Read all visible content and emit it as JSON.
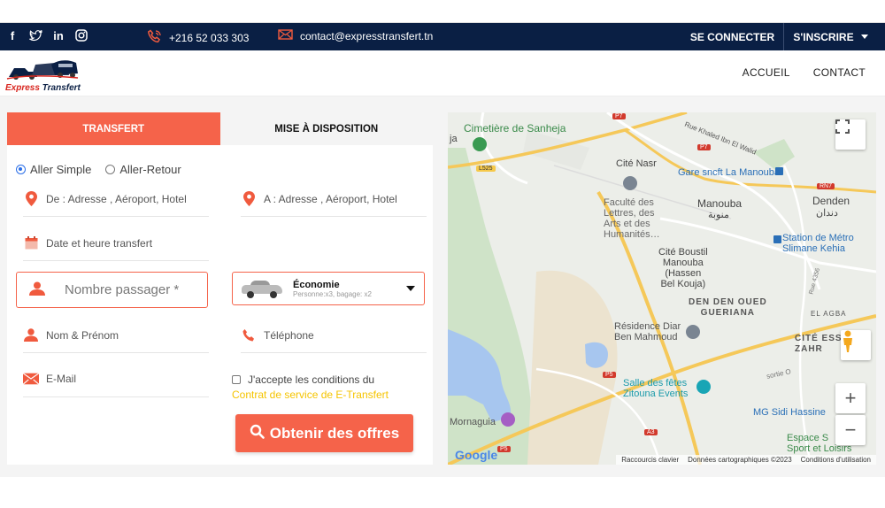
{
  "topbar": {
    "social": [
      "facebook-icon",
      "twitter-icon",
      "linkedin-icon",
      "instagram-icon"
    ],
    "phone": "+216 52 033 303",
    "email": "contact@expresstransfert.tn",
    "login": "SE CONNECTER",
    "signup": "S'INSCRIRE"
  },
  "header": {
    "logo_text_a": "Express",
    "logo_text_b": "Transfert",
    "nav": [
      "ACCUEIL",
      "CONTACT"
    ]
  },
  "form": {
    "tabs": [
      "TRANSFERT",
      "MISE À DISPOSITION"
    ],
    "radio_one_way": "Aller Simple",
    "radio_round": "Aller-Retour",
    "from_placeholder": "De : Adresse , Aéroport, Hotel",
    "to_placeholder": "A : Adresse , Aéroport, Hotel",
    "date_placeholder": "Date et heure transfert",
    "passengers_placeholder": "Nombre passager *",
    "vehicle_title": "Économie",
    "vehicle_sub": "Personne:x3, bagage: x2",
    "name_placeholder": "Nom & Prénom",
    "phone_placeholder": "Téléphone",
    "email_placeholder": "E-Mail",
    "terms_text": "J'accepte les conditions du",
    "terms_link": "Contrat de service de E-Transfert",
    "submit": "Obtenir des offres"
  },
  "map": {
    "labels": {
      "cemetery": "Cimetière de Sanheja",
      "ja": "ja",
      "cite_nasr": "Cité Nasr",
      "gare": "Gare sncft La Manouba",
      "faculte": "Faculté des\nLettres, des\nArts et des\nHumanités…",
      "manouba": "Manouba",
      "manouba_ar": "منوبة",
      "denden": "Denden",
      "denden_ar": "دندان",
      "station": "Station de Métro\nSlimane Kehia",
      "cite_boustil": "Cité Boustil\nManouba\n(Hassen\nBel Kouja)",
      "den_den_oued": "DEN DEN OUED\nGUERIANA",
      "el_agba": "EL AGBA",
      "residence": "Résidence Diar\nBen Mahmoud",
      "cite_ess": "CITÉ ESS\nZAHR",
      "salle": "Salle des fêtes\nZitouna Events",
      "mornaguia": "Mornaguia",
      "mg": "MG Sidi Hassine",
      "espace": "Espace S\nSport et Loisirs",
      "street": "Rue Khaled Ibn El Walid",
      "sortie": "sortie O",
      "rue4356": "Rue 4356"
    },
    "road_badges": [
      "P7",
      "P7",
      "L525",
      "P5",
      "A3",
      "P5",
      "RN7"
    ],
    "google": "Google",
    "attrib": [
      "Raccourcis clavier",
      "Données cartographiques ©2023",
      "Conditions d'utilisation"
    ]
  }
}
